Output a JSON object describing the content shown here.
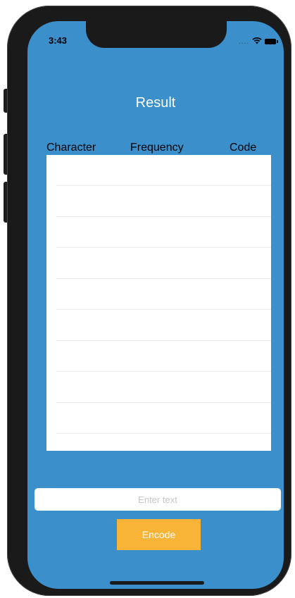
{
  "status_bar": {
    "time": "3:43",
    "signal_dots": "....",
    "wifi_icon": "wifi-icon",
    "battery_icon": "battery-icon"
  },
  "screen": {
    "title": "Result",
    "background_color": "#3b8fcb"
  },
  "table": {
    "columns": [
      "Character",
      "Frequency",
      "Code"
    ],
    "row_count": 9,
    "rows": []
  },
  "input": {
    "value": "",
    "placeholder": "Enter text"
  },
  "encode_button": {
    "label": "Encode",
    "color": "#f7b436"
  }
}
